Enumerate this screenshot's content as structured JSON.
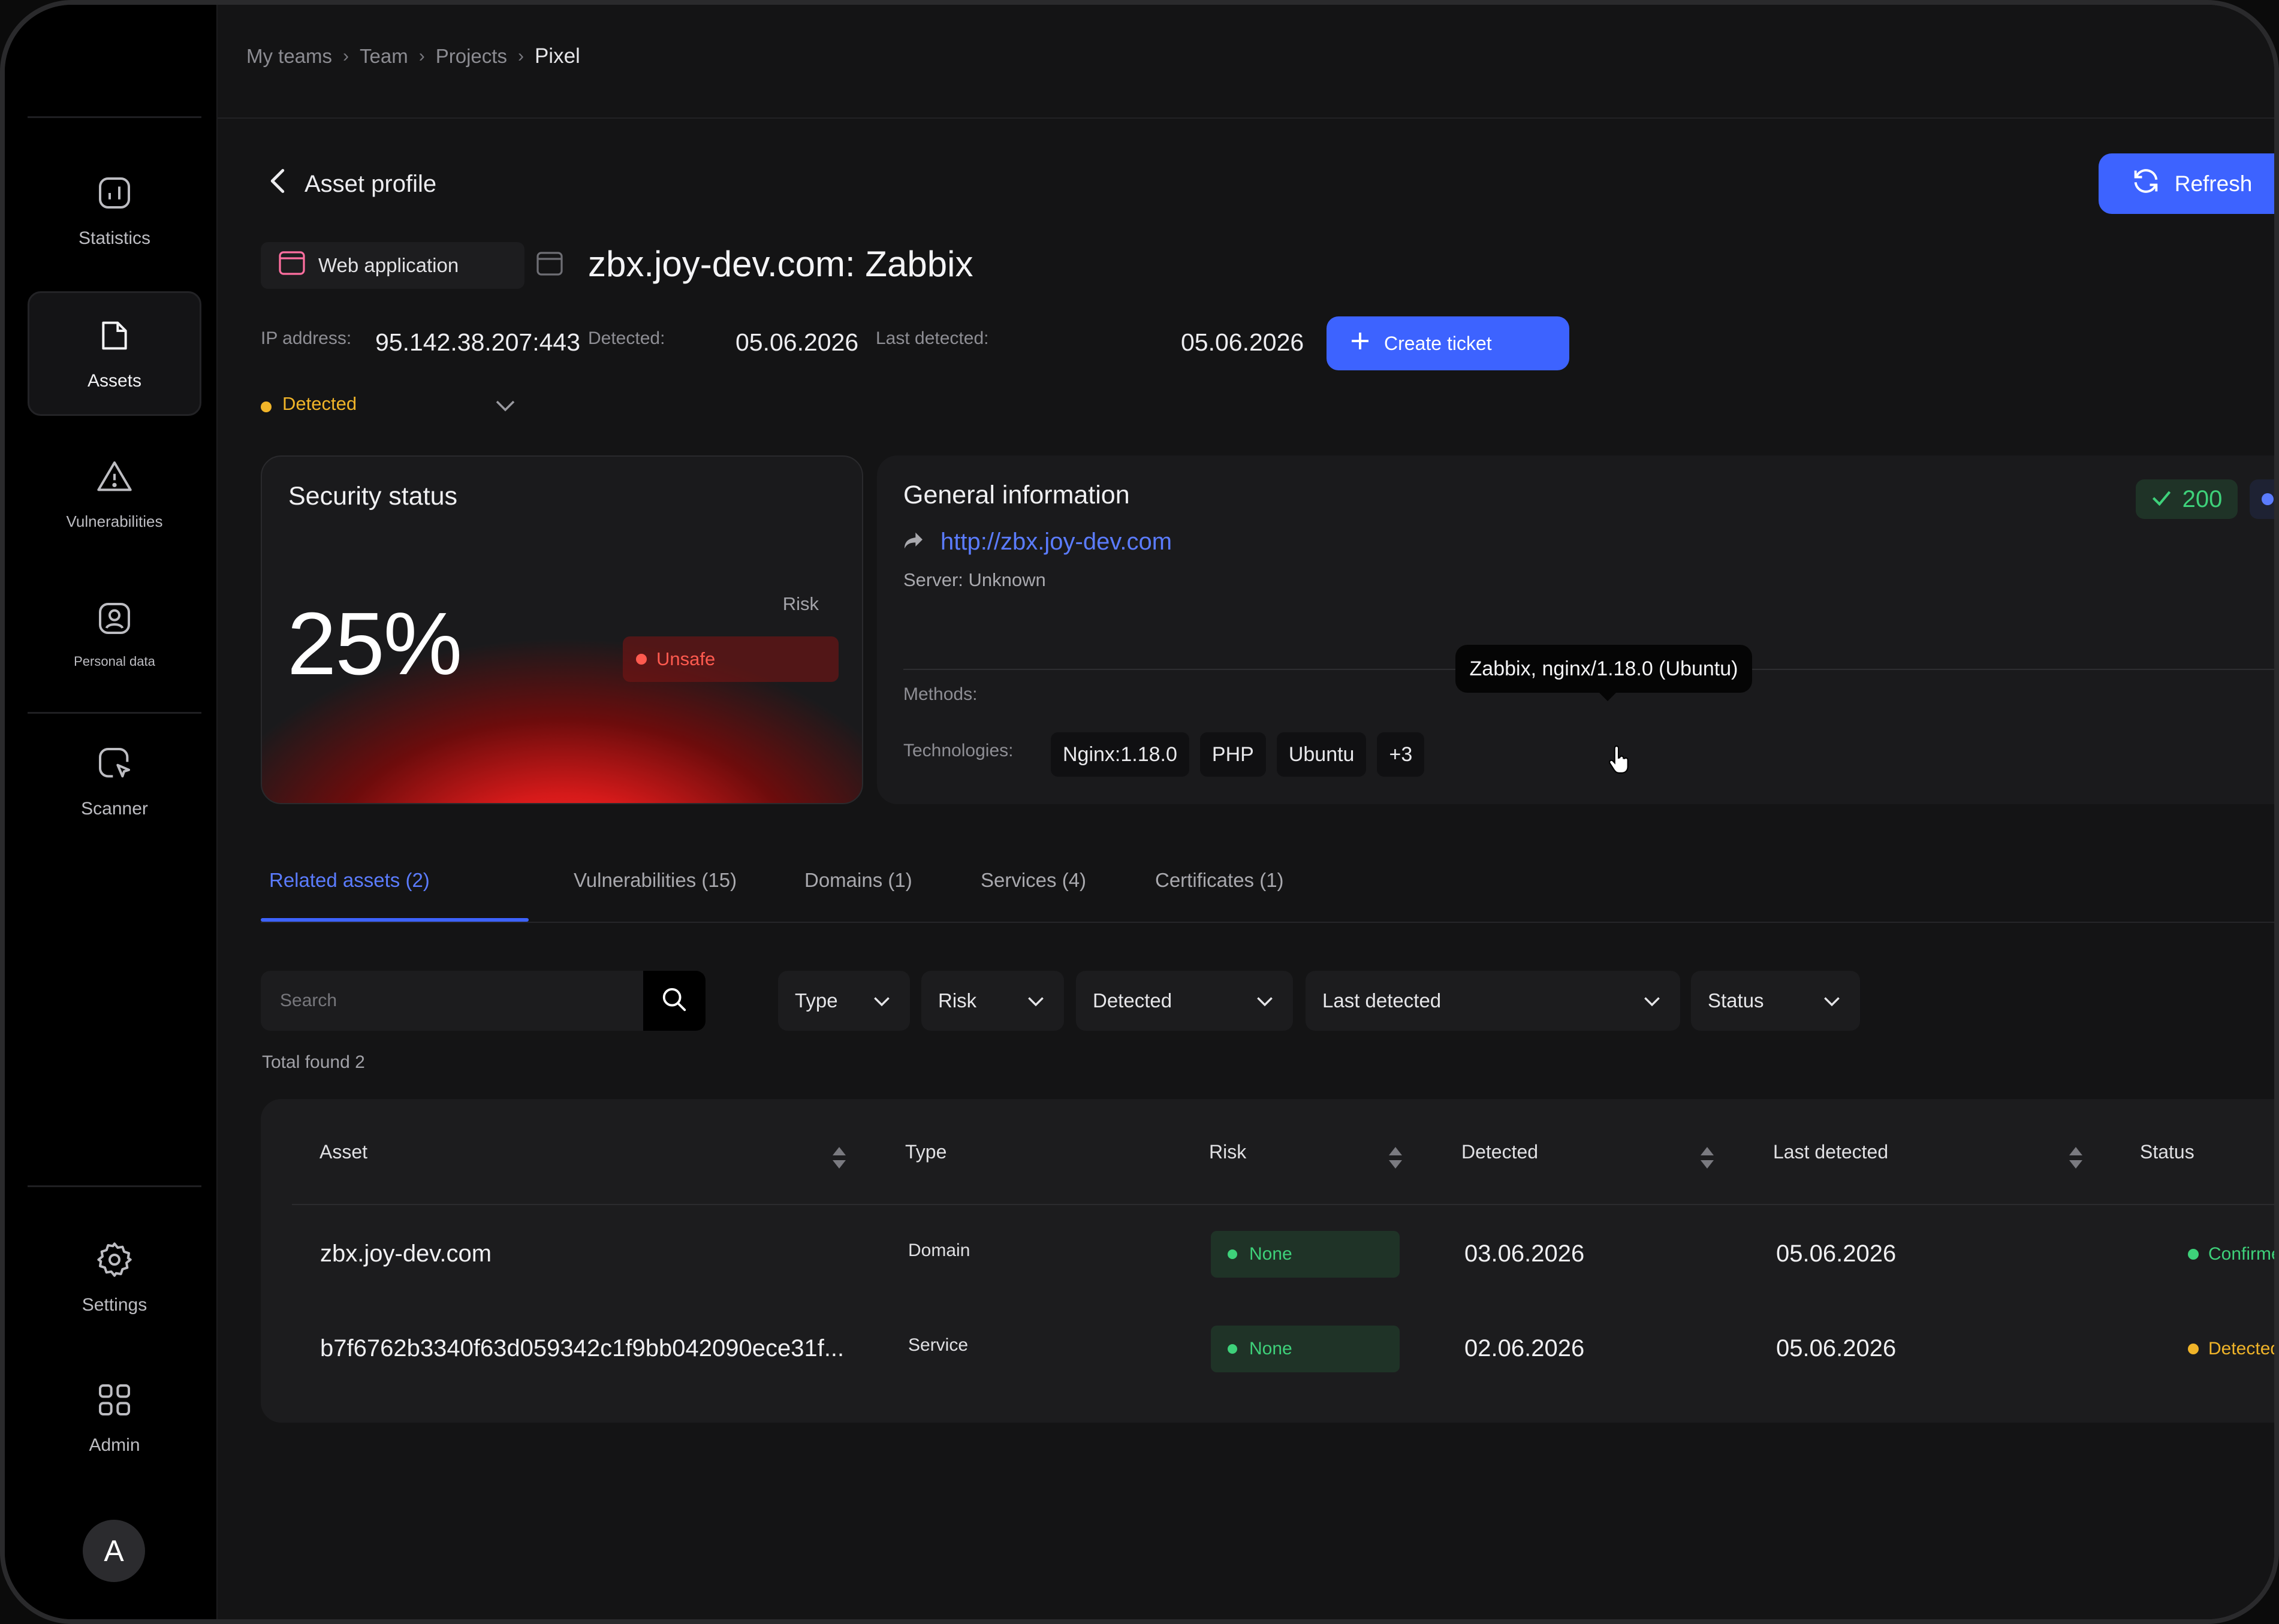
{
  "sidebar": {
    "items": [
      {
        "label": "Statistics",
        "icon": "chart-icon"
      },
      {
        "label": "Assets",
        "icon": "file-icon",
        "active": true
      },
      {
        "label": "Vulnerabilities",
        "icon": "warning-icon"
      },
      {
        "label": "Personal data",
        "icon": "user-icon"
      },
      {
        "label": "Scanner",
        "icon": "scanner-icon"
      },
      {
        "label": "Settings",
        "icon": "gear-icon"
      },
      {
        "label": "Admin",
        "icon": "grid-icon"
      }
    ],
    "avatar": "A"
  },
  "breadcrumbs": [
    "My teams",
    "Team",
    "Projects",
    "Pixel"
  ],
  "header": {
    "back_label": "Asset profile",
    "refresh_label": "Refresh"
  },
  "asset": {
    "type_label": "Web application",
    "title": "zbx.joy-dev.com: Zabbix",
    "ip_label": "IP address:",
    "ip_value": "95.142.38.207:443",
    "detected_label": "Detected:",
    "detected_value": "05.06.2026",
    "last_detected_label": "Last detected:",
    "last_detected_value": "05.06.2026",
    "create_ticket_label": "Create ticket",
    "status": "Detected"
  },
  "security": {
    "title": "Security status",
    "percent": "25%",
    "risk_label": "Risk",
    "risk_value": "Unsafe"
  },
  "general": {
    "title": "General information",
    "url": "http://zbx.joy-dev.com",
    "server": "Server: Unknown",
    "methods_label": "Methods:",
    "technologies_label": "Technologies:",
    "technologies": [
      "Nginx:1.18.0",
      "PHP",
      "Ubuntu",
      "+3"
    ],
    "status_code": "200",
    "tooltip": "Zabbix, nginx/1.18.0 (Ubuntu)"
  },
  "tabs": [
    {
      "label": "Related assets (2)",
      "active": true
    },
    {
      "label": "Vulnerabilities (15)"
    },
    {
      "label": "Domains (1)"
    },
    {
      "label": "Services (4)"
    },
    {
      "label": "Certificates (1)"
    }
  ],
  "filters": {
    "search_placeholder": "Search",
    "type": "Type",
    "risk": "Risk",
    "detected": "Detected",
    "last_detected": "Last detected",
    "status": "Status"
  },
  "total_found": "Total found 2",
  "table": {
    "columns": [
      "Asset",
      "Type",
      "Risk",
      "Detected",
      "Last detected",
      "Status"
    ],
    "rows": [
      {
        "asset": "zbx.joy-dev.com",
        "type": "Domain",
        "risk": "None",
        "detected": "03.06.2026",
        "last_detected": "05.06.2026",
        "status": "Confirmed"
      },
      {
        "asset": "b7f6762b3340f63d059342c1f9bb042090ece31f...",
        "type": "Service",
        "risk": "None",
        "detected": "02.06.2026",
        "last_detected": "05.06.2026",
        "status": "Detected"
      }
    ]
  },
  "colors": {
    "accent": "#3d63ff",
    "detected": "#f0b429",
    "confirmed": "#3ed17a",
    "unsafe": "#ff5a4f",
    "background": "#141415"
  }
}
